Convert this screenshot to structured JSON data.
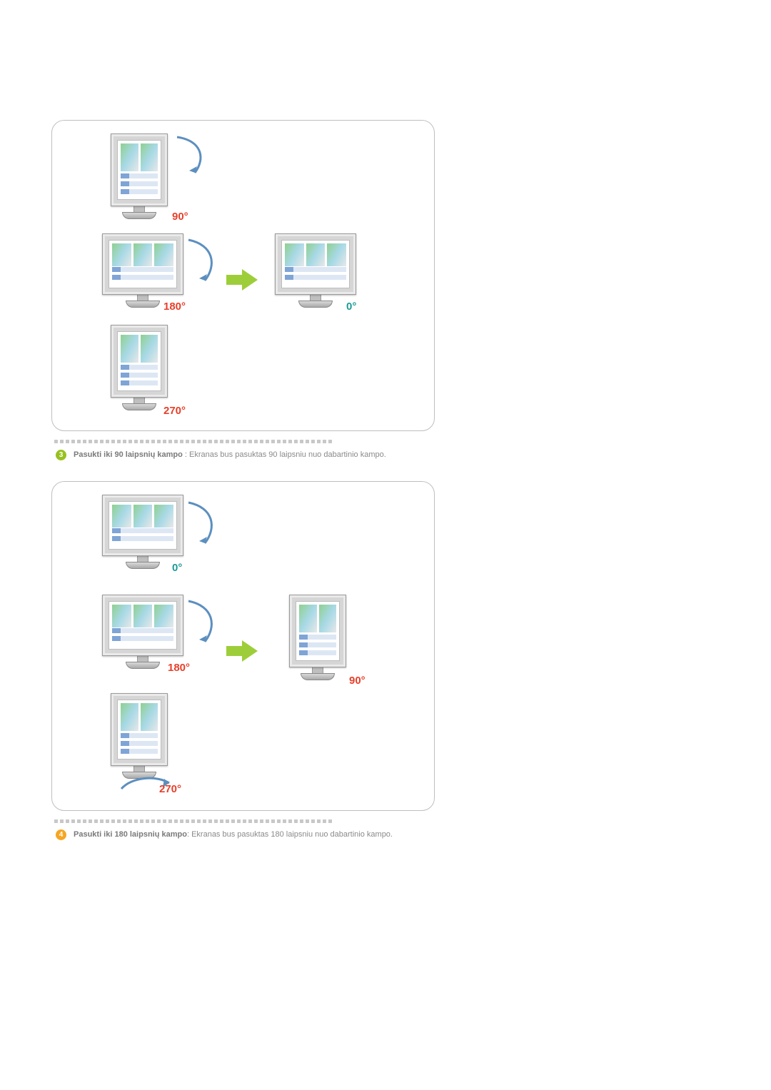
{
  "diagram1": {
    "labels": {
      "a90": "90°",
      "a180": "180°",
      "a270": "270°",
      "a0": "0°"
    }
  },
  "item3": {
    "badge": "3",
    "title": "Pasukti iki 90 laipsnių kampo",
    "sep": " : ",
    "desc": "Ekranas bus pasuktas 90 laipsniu nuo dabartinio kampo."
  },
  "diagram2": {
    "labels": {
      "a0": "0°",
      "a180": "180°",
      "a90": "90°",
      "a270": "270°"
    }
  },
  "item4": {
    "badge": "4",
    "title": "Pasukti iki 180 laipsnių kampo",
    "sep": ": ",
    "desc": "Ekranas bus pasuktas 180 laipsniu nuo dabartinio kampo."
  }
}
